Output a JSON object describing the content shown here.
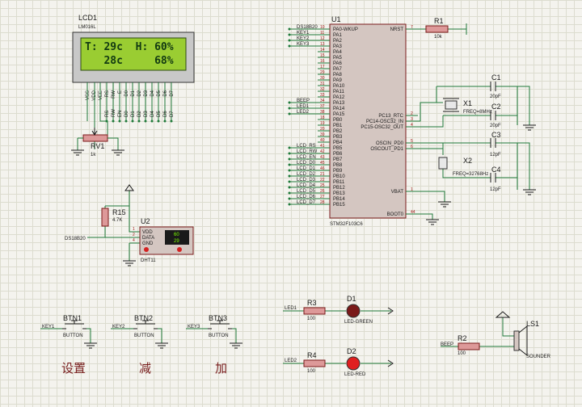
{
  "mcu": {
    "ref": "U1",
    "part": "STM32F103C6",
    "left_pins": [
      {
        "no": "10",
        "name": "PA0-WKUP",
        "net": "DS18B20"
      },
      {
        "no": "11",
        "name": "PA1",
        "net": "KEY1"
      },
      {
        "no": "12",
        "name": "PA2",
        "net": "KEY2"
      },
      {
        "no": "13",
        "name": "PA3",
        "net": "KEY3"
      },
      {
        "no": "14",
        "name": "PA4",
        "net": ""
      },
      {
        "no": "15",
        "name": "PA5",
        "net": ""
      },
      {
        "no": "16",
        "name": "PA6",
        "net": ""
      },
      {
        "no": "17",
        "name": "PA7",
        "net": ""
      },
      {
        "no": "29",
        "name": "PA8",
        "net": ""
      },
      {
        "no": "30",
        "name": "PA9",
        "net": ""
      },
      {
        "no": "31",
        "name": "PA10",
        "net": ""
      },
      {
        "no": "32",
        "name": "PA11",
        "net": ""
      },
      {
        "no": "33",
        "name": "PA12",
        "net": ""
      },
      {
        "no": "34",
        "name": "PA13",
        "net": "BEEP"
      },
      {
        "no": "37",
        "name": "PA14",
        "net": "LED1"
      },
      {
        "no": "38",
        "name": "PA15",
        "net": "LED2"
      },
      {
        "no": "18",
        "name": "PB0",
        "net": ""
      },
      {
        "no": "19",
        "name": "PB1",
        "net": ""
      },
      {
        "no": "20",
        "name": "PB2",
        "net": ""
      },
      {
        "no": "39",
        "name": "PB3",
        "net": ""
      },
      {
        "no": "40",
        "name": "PB4",
        "net": ""
      },
      {
        "no": "41",
        "name": "PB5",
        "net": "LCD_RS"
      },
      {
        "no": "42",
        "name": "PB6",
        "net": "LCD_RW"
      },
      {
        "no": "43",
        "name": "PB7",
        "net": "LCD_EN"
      },
      {
        "no": "45",
        "name": "PB8",
        "net": "LCD_D0"
      },
      {
        "no": "46",
        "name": "PB9",
        "net": "LCD_D1"
      },
      {
        "no": "21",
        "name": "PB10",
        "net": "LCD_D2"
      },
      {
        "no": "22",
        "name": "PB11",
        "net": "LCD_D3"
      },
      {
        "no": "25",
        "name": "PB12",
        "net": "LCD_D4"
      },
      {
        "no": "26",
        "name": "PB13",
        "net": "LCD_D5"
      },
      {
        "no": "27",
        "name": "PB14",
        "net": "LCD_D6"
      },
      {
        "no": "28",
        "name": "PB15",
        "net": "LCD_D7"
      }
    ],
    "right_pins": [
      {
        "no": "7",
        "name": "NRST"
      },
      {
        "no": "2",
        "name": "PC13_RTC"
      },
      {
        "no": "3",
        "name": "PC14-OSC32_IN"
      },
      {
        "no": "4",
        "name": "PC15-OSC32_OUT"
      },
      {
        "no": "5",
        "name": "OSCIN_PD0"
      },
      {
        "no": "6",
        "name": "OSCOUT_PD1"
      },
      {
        "no": "1",
        "name": "VBAT"
      },
      {
        "no": "44",
        "name": "BOOT0"
      }
    ]
  },
  "lcd": {
    "ref": "LCD1",
    "part": "LM016L",
    "line1": "T: 29c  H: 60%",
    "line2": "   28c     68%",
    "pins": [
      "VSS",
      "VDD",
      "VEE",
      "RS",
      "RW",
      "E",
      "D0",
      "D1",
      "D2",
      "D3",
      "D4",
      "D5",
      "D6",
      "D7"
    ],
    "nets": [
      "LCD_RS",
      "LCD_RW",
      "LCD_EN",
      "LCD_D0",
      "LCD_D1",
      "LCD_D2",
      "LCD_D3",
      "LCD_D4",
      "LCD_D5",
      "LCD_D6",
      "LCD_D7"
    ]
  },
  "rv1": {
    "ref": "RV1",
    "value": "1k"
  },
  "r1": {
    "ref": "R1",
    "value": "10k"
  },
  "r15": {
    "ref": "R15",
    "value": "4.7K"
  },
  "dht": {
    "ref": "U2",
    "part": "DHT11",
    "pins": [
      "VDD",
      "DATA",
      "GND"
    ],
    "temp": "60",
    "hum": "29",
    "net": "DS18B20",
    "pin_nos": [
      "1",
      "2",
      "4"
    ]
  },
  "crystals": [
    {
      "ref": "X1",
      "value": "FREQ=8MHz"
    },
    {
      "ref": "X2",
      "value": "FREQ=32768Hz"
    }
  ],
  "caps": [
    {
      "ref": "C1",
      "value": "20pF"
    },
    {
      "ref": "C2",
      "value": "20pF"
    },
    {
      "ref": "C3",
      "value": "12pF"
    },
    {
      "ref": "C4",
      "value": "12pF"
    }
  ],
  "buttons": [
    {
      "ref": "BTN1",
      "net": "KEY1",
      "part": "BUTTON",
      "label": "设置"
    },
    {
      "ref": "BTN2",
      "net": "KEY2",
      "part": "BUTTON",
      "label": "减"
    },
    {
      "ref": "BTN3",
      "net": "KEY3",
      "part": "BUTTON",
      "label": "加"
    }
  ],
  "leds": [
    {
      "ref": "D1",
      "net": "LED1",
      "res": "R3",
      "res_value": "100",
      "part": "LED-GREEN",
      "color": "#7a1a1a"
    },
    {
      "ref": "D2",
      "net": "LED2",
      "res": "R4",
      "res_value": "100",
      "part": "LED-RED",
      "color": "#e02020"
    }
  ],
  "sounder": {
    "ref": "LS1",
    "part": "SOUNDER",
    "res": "R2",
    "res_value": "100",
    "net": "BEEP"
  }
}
